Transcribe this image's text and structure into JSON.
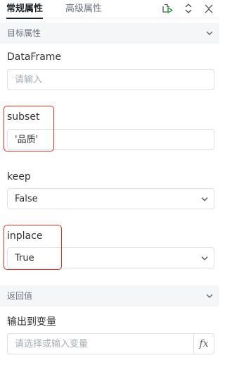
{
  "tabs": {
    "general": "常规属性",
    "advanced": "高级属性"
  },
  "target_section": {
    "title": "目标属性"
  },
  "fields": {
    "dataframe": {
      "label": "DataFrame",
      "placeholder": "请输入"
    },
    "subset": {
      "label": "subset",
      "value": "'品质'"
    },
    "keep": {
      "label": "keep",
      "value": "False"
    },
    "inplace": {
      "label": "inplace",
      "value": "True"
    }
  },
  "return_section": {
    "title": "返回值"
  },
  "output": {
    "label": "输出到变量",
    "placeholder": "请选择或输入变量",
    "fx_label": "fx"
  },
  "colors": {
    "accent": "#2f9e44",
    "highlight": "#d9362b",
    "border": "#dcdfe6"
  }
}
